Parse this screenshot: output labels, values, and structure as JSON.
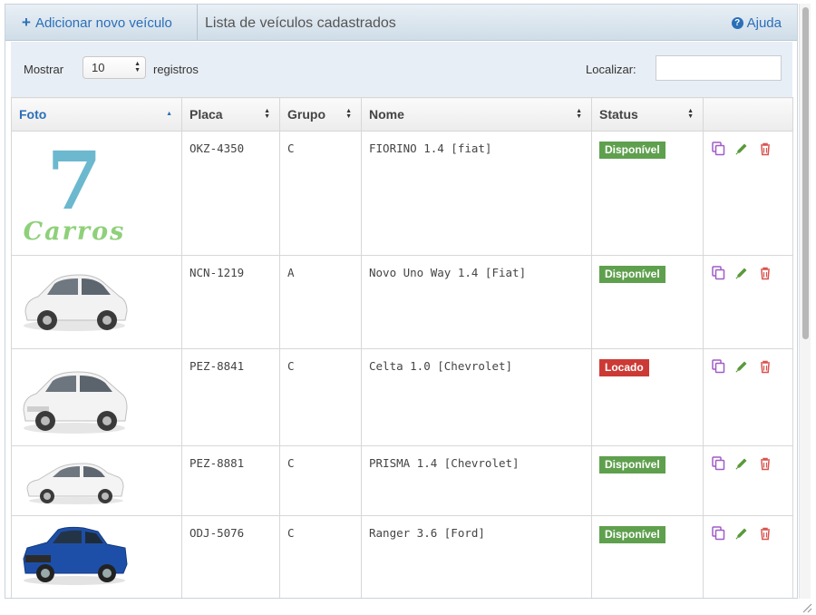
{
  "topbar": {
    "add_label": "Adicionar novo veículo",
    "title": "Lista de veículos cadastrados",
    "help_label": "Ajuda"
  },
  "toolbar": {
    "show_label": "Mostrar",
    "page_size": "10",
    "records_label": "registros",
    "search_label": "Localizar:",
    "search_value": ""
  },
  "table": {
    "columns": [
      "Foto",
      "Placa",
      "Grupo",
      "Nome",
      "Status"
    ],
    "rows": [
      {
        "photo": "logo-7-carros",
        "plate": "OKZ-4350",
        "group": "C",
        "name": "FIORINO 1.4 [fiat]",
        "status": "Disponível",
        "status_kind": "available"
      },
      {
        "photo": "white-hatchback",
        "plate": "NCN-1219",
        "group": "A",
        "name": "Novo Uno Way 1.4 [Fiat]",
        "status": "Disponível",
        "status_kind": "available"
      },
      {
        "photo": "white-hatchback",
        "plate": "PEZ-8841",
        "group": "C",
        "name": "Celta 1.0 [Chevrolet]",
        "status": "Locado",
        "status_kind": "rented"
      },
      {
        "photo": "white-sedan",
        "plate": "PEZ-8881",
        "group": "C",
        "name": "PRISMA 1.4 [Chevrolet]",
        "status": "Disponível",
        "status_kind": "available"
      },
      {
        "photo": "blue-pickup",
        "plate": "ODJ-5076",
        "group": "C",
        "name": "Ranger 3.6 [Ford]",
        "status": "Disponível",
        "status_kind": "available"
      }
    ]
  },
  "logo": {
    "number": "7",
    "word": "Carros"
  },
  "icons": {
    "copy": "copy-icon",
    "edit": "pencil-icon",
    "delete": "trash-icon"
  },
  "colors": {
    "link": "#2a6fb8",
    "available": "#5fa04e",
    "rented": "#cc3a35",
    "copy": "#a05cc8",
    "edit": "#5a9a3a",
    "delete": "#d9534f"
  }
}
